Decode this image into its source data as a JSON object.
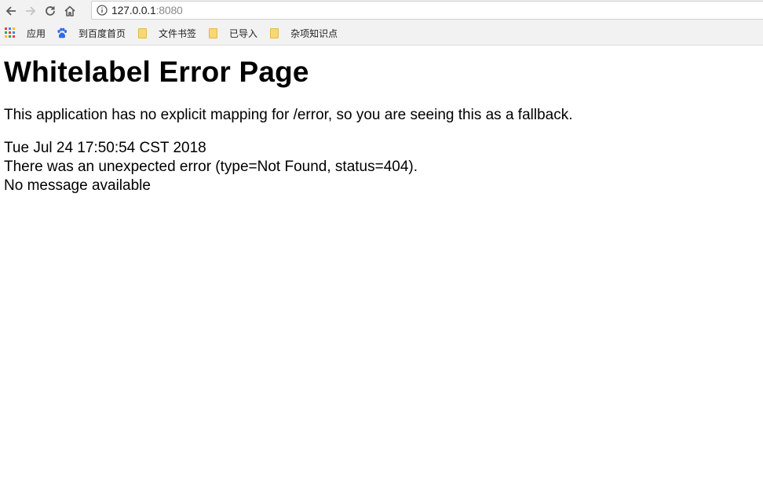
{
  "browser": {
    "address": {
      "host": "127.0.0.1",
      "port": ":8080"
    },
    "bookmarks": [
      {
        "label": "应用",
        "icon": "apps-grid-icon"
      },
      {
        "label": "到百度首页",
        "icon": "baidu-paw-icon"
      },
      {
        "label": "文件书签",
        "icon": "folder-icon"
      },
      {
        "label": "已导入",
        "icon": "folder-icon"
      },
      {
        "label": "杂项知识点",
        "icon": "folder-icon"
      }
    ]
  },
  "page": {
    "title": "Whitelabel Error Page",
    "description": "This application has no explicit mapping for /error, so you are seeing this as a fallback.",
    "timestamp": "Tue Jul 24 17:50:54 CST 2018",
    "error_line": "There was an unexpected error (type=Not Found, status=404).",
    "message": "No message available"
  },
  "colors": {
    "toolbar_bg": "#f2f2f2",
    "port_text": "#8a8a8a",
    "folder": "#f8d775",
    "baidu_blue": "#2e6be6"
  }
}
